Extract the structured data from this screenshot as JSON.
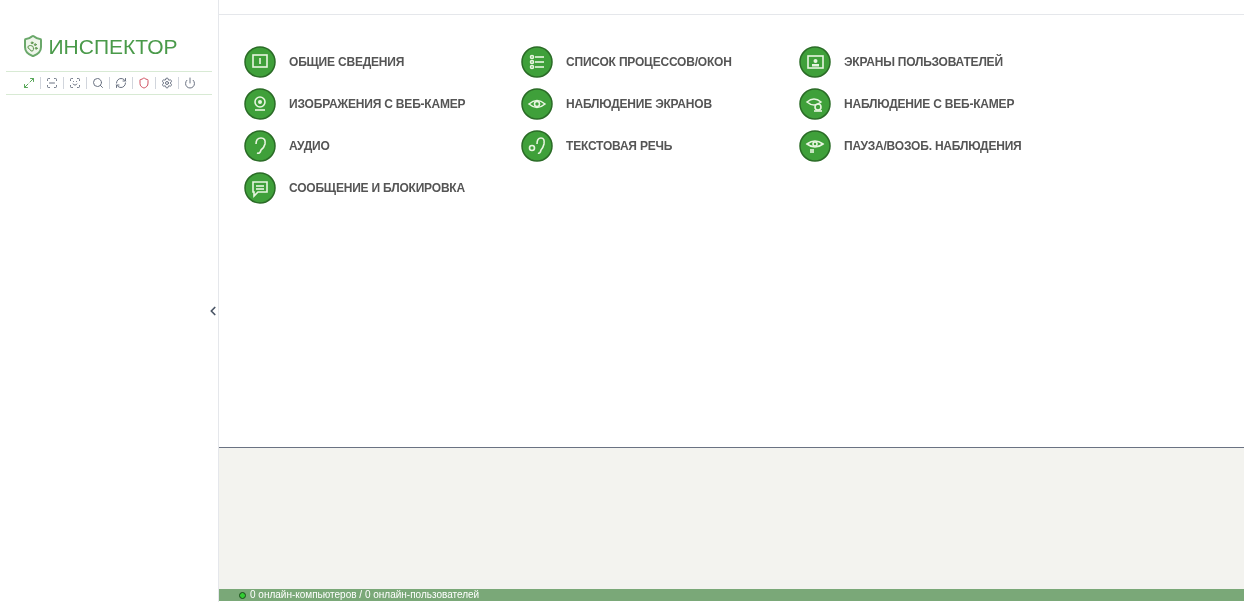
{
  "logo": {
    "text": "ИНСПЕКТОР"
  },
  "actions": [
    {
      "label": "ОБЩИЕ СВЕДЕНИЯ",
      "kind": "info"
    },
    {
      "label": "СПИСОК ПРОЦЕССОВ/ОКОН",
      "kind": "list"
    },
    {
      "label": "ЭКРАНЫ ПОЛЬЗОВАТЕЛЕЙ",
      "kind": "screens"
    },
    {
      "label": "ИЗОБРАЖЕНИЯ С ВЕБ-КАМЕР",
      "kind": "webcam"
    },
    {
      "label": "НАБЛЮДЕНИЕ ЭКРАНОВ",
      "kind": "eye"
    },
    {
      "label": "НАБЛЮДЕНИЕ С ВЕБ-КАМЕР",
      "kind": "eye-cam"
    },
    {
      "label": "АУДИО",
      "kind": "ear"
    },
    {
      "label": "ТЕКСТОВАЯ РЕЧЬ",
      "kind": "speech"
    },
    {
      "label": "ПАУЗА/ВОЗОБ. НАБЛЮДЕНИЯ",
      "kind": "pause"
    },
    {
      "label": "СООБЩЕНИЕ И БЛОКИРОВКА",
      "kind": "message"
    }
  ],
  "status_bar": {
    "text": "0 онлайн-компьютеров / 0 онлайн-пользователей"
  }
}
